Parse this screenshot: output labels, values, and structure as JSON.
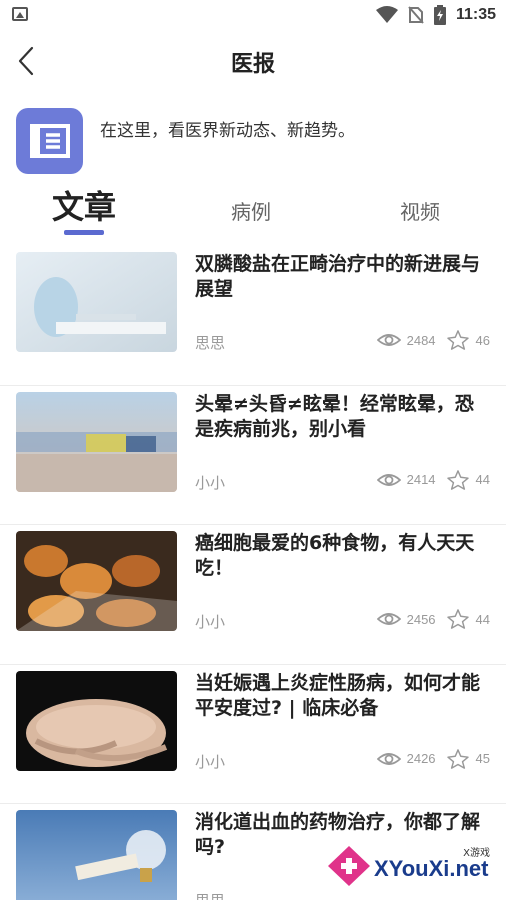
{
  "statusbar": {
    "time": "11:35"
  },
  "header": {
    "title": "医报"
  },
  "banner": {
    "text": "在这里，看医界新动态、新趋势。"
  },
  "tabs": [
    {
      "label": "文章",
      "active": true
    },
    {
      "label": "病例",
      "active": false
    },
    {
      "label": "视频",
      "active": false
    }
  ],
  "articles": [
    {
      "title": "双膦酸盐在正畸治疗中的新进展与展望",
      "author": "思思",
      "views": "2484",
      "stars": "46"
    },
    {
      "title": "头晕≠头昏≠眩晕！经常眩晕，恐是疾病前兆，别小看",
      "author": "小小",
      "views": "2414",
      "stars": "44"
    },
    {
      "title": "癌细胞最爱的6种食物，有人天天吃！",
      "author": "小小",
      "views": "2456",
      "stars": "44"
    },
    {
      "title": "当妊娠遇上炎症性肠病，如何才能平安度过? | 临床必备",
      "author": "小小",
      "views": "2426",
      "stars": "45"
    },
    {
      "title": " 消化道出血的药物治疗，你都了解吗?",
      "author": "思思",
      "views": "",
      "stars": ""
    }
  ],
  "watermark": {
    "brand": "XYouXi.net",
    "sub": "X游戏"
  },
  "colors": {
    "accent": "#5b6ad0",
    "logo": "#6d7bd8"
  }
}
